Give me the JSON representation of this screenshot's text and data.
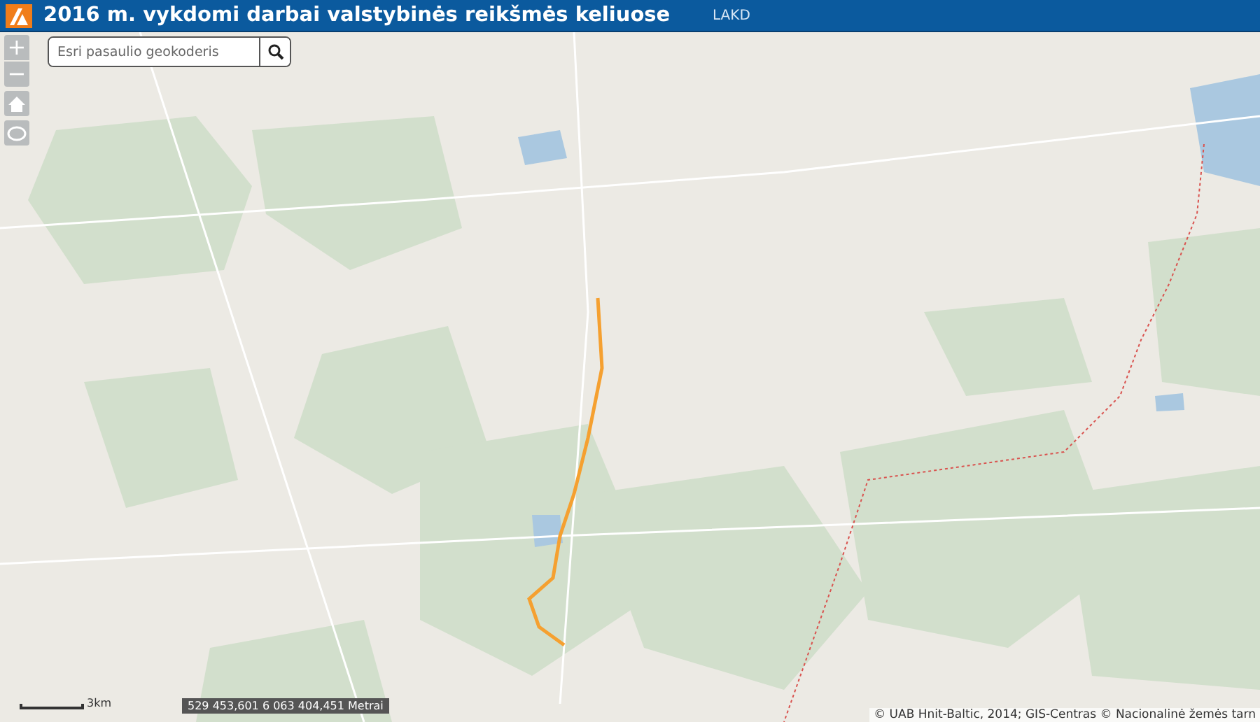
{
  "header": {
    "title": "2016 m. vykdomi darbai valstybinės reikšmės keliuose",
    "agency": "LAKD"
  },
  "zoom_controls": [
    {
      "kind": "zoom-in",
      "label": "+"
    },
    {
      "kind": "zoom-out",
      "label": "−"
    }
  ],
  "search": {
    "placeholder": "Esri pasaulio geokoderis"
  },
  "scale_bar": {
    "label": "3km"
  },
  "coordinates": "529 453,601 6 063 404,451 Metrai",
  "attribution": "© UAB Hnit-Baltic, 2014; GIS-Centras © Nacionalinė žemės tarn"
}
